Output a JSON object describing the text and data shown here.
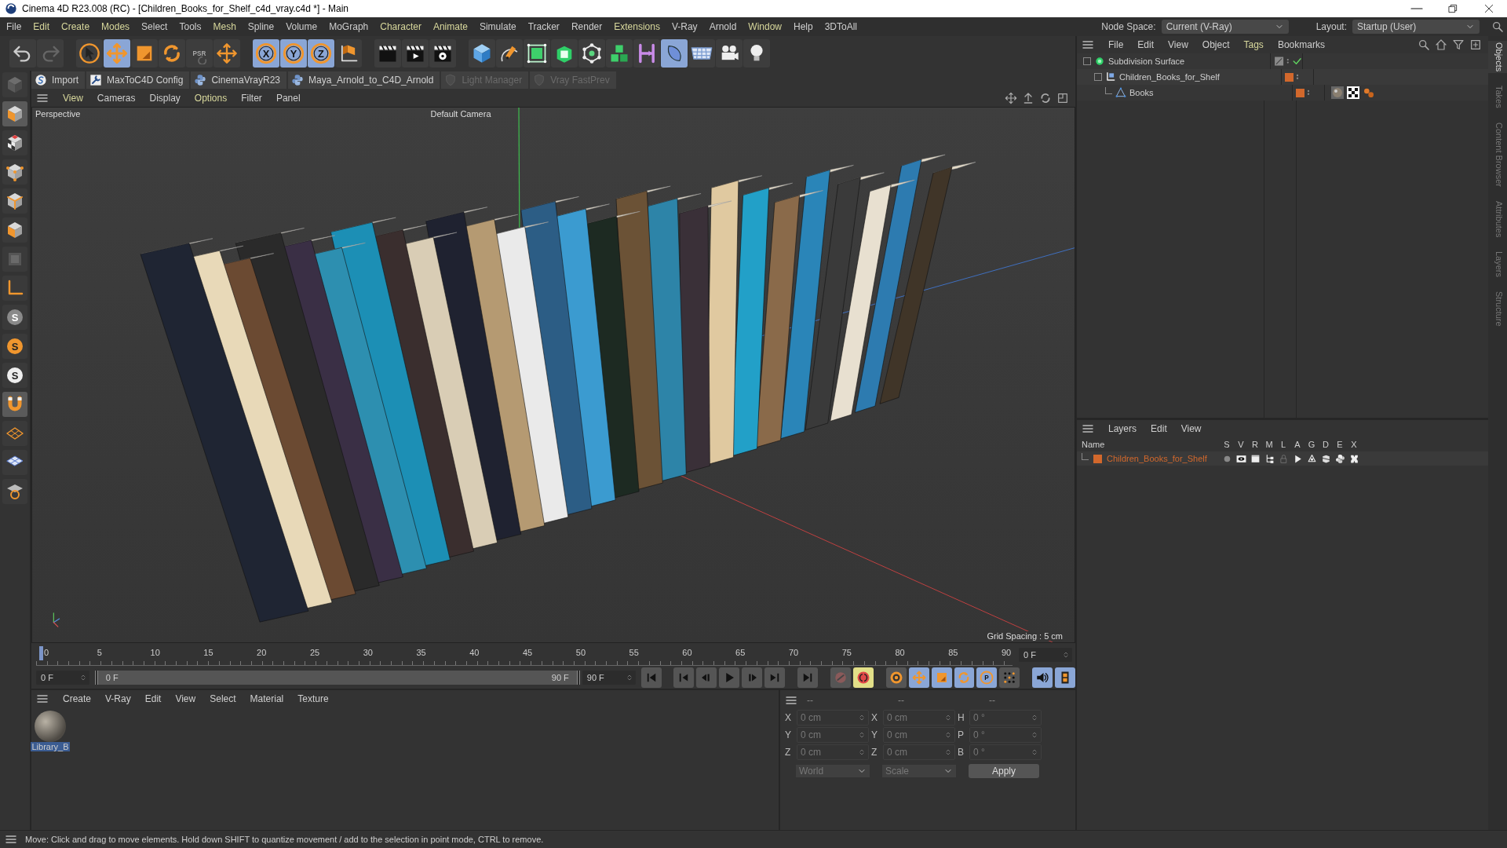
{
  "window": {
    "title": "Cinema 4D R23.008 (RC) - [Children_Books_for_Shelf_c4d_vray.c4d *] - Main"
  },
  "menu": [
    {
      "label": "File",
      "tinted": false
    },
    {
      "label": "Edit",
      "tinted": true
    },
    {
      "label": "Create",
      "tinted": true
    },
    {
      "label": "Modes",
      "tinted": true
    },
    {
      "label": "Select",
      "tinted": false
    },
    {
      "label": "Tools",
      "tinted": false
    },
    {
      "label": "Mesh",
      "tinted": true
    },
    {
      "label": "Spline",
      "tinted": false
    },
    {
      "label": "Volume",
      "tinted": false
    },
    {
      "label": "MoGraph",
      "tinted": false
    },
    {
      "label": "Character",
      "tinted": true
    },
    {
      "label": "Animate",
      "tinted": true
    },
    {
      "label": "Simulate",
      "tinted": false
    },
    {
      "label": "Tracker",
      "tinted": false
    },
    {
      "label": "Render",
      "tinted": false
    },
    {
      "label": "Extensions",
      "tinted": true
    },
    {
      "label": "V-Ray",
      "tinted": false
    },
    {
      "label": "Arnold",
      "tinted": false
    },
    {
      "label": "Window",
      "tinted": true
    },
    {
      "label": "Help",
      "tinted": false
    },
    {
      "label": "3DToAll",
      "tinted": false
    }
  ],
  "node_space": {
    "label": "Node Space:",
    "value": "Current (V-Ray)"
  },
  "layout": {
    "label": "Layout:",
    "value": "Startup (User)"
  },
  "toolbar": [
    {
      "kind": "undo",
      "selected": false
    },
    {
      "kind": "redo",
      "selected": false
    },
    {
      "kind": "cursor",
      "selected": false
    },
    {
      "kind": "move",
      "selected": true
    },
    {
      "kind": "scale",
      "selected": false
    },
    {
      "kind": "rotate",
      "selected": false
    },
    {
      "kind": "psr",
      "glyph": "PSR",
      "selected": false
    },
    {
      "kind": "add",
      "selected": false
    },
    {
      "kind": "axis",
      "glyph": "X",
      "selected": true
    },
    {
      "kind": "axis",
      "glyph": "Y",
      "selected": true
    },
    {
      "kind": "axis",
      "glyph": "Z",
      "selected": true
    },
    {
      "kind": "coordinate",
      "selected": false
    },
    {
      "kind": "clapper",
      "selected": false
    },
    {
      "kind": "render",
      "selected": false
    },
    {
      "kind": "render-settings",
      "selected": false
    },
    {
      "kind": "cube",
      "selected": false
    },
    {
      "kind": "pen",
      "selected": false
    },
    {
      "kind": "subdivision",
      "selected": false
    },
    {
      "kind": "extrude",
      "selected": false
    },
    {
      "kind": "mograph",
      "selected": false
    },
    {
      "kind": "cubes",
      "selected": false
    },
    {
      "kind": "deformer",
      "selected": false
    },
    {
      "kind": "field",
      "selected": true
    },
    {
      "kind": "floor",
      "selected": false
    },
    {
      "kind": "camera",
      "selected": false
    },
    {
      "kind": "light",
      "selected": false
    }
  ],
  "plugin_bar": [
    {
      "label": "Import",
      "kind": "script",
      "disabled": false
    },
    {
      "label": "MaxToC4D Config",
      "kind": "wrench",
      "disabled": false
    },
    {
      "label": "CinemaVrayR23",
      "kind": "python",
      "disabled": false
    },
    {
      "label": "Maya_Arnold_to_C4D_Arnold",
      "kind": "python",
      "disabled": false
    },
    {
      "label": "Light Manager",
      "kind": "shield",
      "disabled": true
    },
    {
      "label": "Vray FastPrev",
      "kind": "shield",
      "disabled": true
    }
  ],
  "left_tools": [
    {
      "kind": "camera-cube",
      "selected": false
    },
    {
      "kind": "model",
      "selected": true
    },
    {
      "kind": "texture",
      "selected": false
    },
    {
      "kind": "points",
      "selected": false
    },
    {
      "kind": "edges",
      "selected": false
    },
    {
      "kind": "polygons",
      "selected": false
    },
    {
      "kind": "uv",
      "selected": false
    },
    {
      "kind": "axis-corner",
      "selected": false
    },
    {
      "kind": "snap",
      "glyph": "S",
      "selected": false
    },
    {
      "kind": "snap-orange",
      "glyph": "S",
      "selected": false
    },
    {
      "kind": "snap-white",
      "glyph": "S",
      "selected": false
    },
    {
      "kind": "magnet",
      "selected": true
    },
    {
      "kind": "workplane",
      "selected": false
    },
    {
      "kind": "grid",
      "selected": false
    },
    {
      "kind": "grid-snap",
      "selected": false
    }
  ],
  "viewport": {
    "menu": [
      {
        "label": "View",
        "tinted": true
      },
      {
        "label": "Cameras",
        "tinted": false
      },
      {
        "label": "Display",
        "tinted": false
      },
      {
        "label": "Options",
        "tinted": true
      },
      {
        "label": "Filter",
        "tinted": false
      },
      {
        "label": "Panel",
        "tinted": false
      }
    ],
    "view_name": "Perspective",
    "camera": "Default Camera",
    "grid_spacing": "Grid Spacing : 5 cm"
  },
  "timeline": {
    "ticks": [
      "0",
      "5",
      "10",
      "15",
      "20",
      "25",
      "30",
      "35",
      "40",
      "45",
      "50",
      "55",
      "60",
      "65",
      "70",
      "75",
      "80",
      "85",
      "90"
    ],
    "current": "0 F",
    "start": "0 F",
    "range": {
      "start": "0 F",
      "end": "90 F",
      "level": 1
    },
    "end": "90 F"
  },
  "transport": [
    {
      "kind": "first",
      "selected": false
    },
    {
      "kind": "prev-key",
      "selected": false
    },
    {
      "kind": "prev-frame",
      "selected": false
    },
    {
      "kind": "play",
      "selected": false
    },
    {
      "kind": "next-frame",
      "selected": false
    },
    {
      "kind": "next-key",
      "selected": false
    },
    {
      "kind": "last",
      "selected": false
    },
    {
      "kind": "autokey",
      "selected": false
    },
    {
      "kind": "record",
      "selected": true
    },
    {
      "kind": "keyset",
      "selected": false
    },
    {
      "kind": "move",
      "selected": true
    },
    {
      "kind": "scale",
      "selected": true
    },
    {
      "kind": "rotate",
      "selected": true
    },
    {
      "kind": "param",
      "glyph": "P",
      "selected": true
    },
    {
      "kind": "dots",
      "selected": false
    },
    {
      "kind": "sound",
      "selected": true
    },
    {
      "kind": "film",
      "selected": true
    }
  ],
  "material_manager": {
    "menu": [
      "Create",
      "V-Ray",
      "Edit",
      "View",
      "Select",
      "Material",
      "Texture"
    ],
    "materials": [
      {
        "name": "Library_B",
        "selected": true
      }
    ]
  },
  "coordinates": {
    "headers": [
      "--",
      "--",
      "--"
    ],
    "rows": [
      {
        "pos_label": "X",
        "pos": "0 cm",
        "size_label": "X",
        "size": "0 cm",
        "rot_label": "H",
        "rot": "0 °"
      },
      {
        "pos_label": "Y",
        "pos": "0 cm",
        "size_label": "Y",
        "size": "0 cm",
        "rot_label": "P",
        "rot": "0 °"
      },
      {
        "pos_label": "Z",
        "pos": "0 cm",
        "size_label": "Z",
        "size": "0 cm",
        "rot_label": "B",
        "rot": "0 °"
      }
    ],
    "mode": "World",
    "transform": "Scale",
    "apply": "Apply"
  },
  "objects": {
    "menu": [
      {
        "label": "File",
        "tinted": false
      },
      {
        "label": "Edit",
        "tinted": false
      },
      {
        "label": "View",
        "tinted": false
      },
      {
        "label": "Object",
        "tinted": false
      },
      {
        "label": "Tags",
        "tinted": true
      },
      {
        "label": "Bookmarks",
        "tinted": false
      }
    ],
    "tree": [
      {
        "name": "Subdivision Surface",
        "kind": "subdivision",
        "enabled": true,
        "children": [
          {
            "name": "Children_Books_for_Shelf",
            "kind": "null",
            "color": "#d2682c",
            "children": [
              {
                "name": "Books",
                "kind": "polygon",
                "color": "#d2682c",
                "tags": [
                  {
                    "kind": "material"
                  },
                  {
                    "kind": "checker"
                  },
                  {
                    "kind": "vray"
                  }
                ]
              }
            ]
          }
        ]
      }
    ]
  },
  "layers": {
    "menu": [
      "Layers",
      "Edit",
      "View"
    ],
    "columns": [
      "Name",
      "S",
      "V",
      "R",
      "M",
      "L",
      "A",
      "G",
      "D",
      "E",
      "X"
    ],
    "rows": [
      {
        "name": "Children_Books_for_Shelf",
        "color": "#d2682c"
      }
    ]
  },
  "side_tabs": [
    {
      "label": "Objects",
      "selected": true
    },
    {
      "label": "Takes",
      "selected": false
    },
    {
      "label": "Content Browser",
      "selected": false
    },
    {
      "label": "Attributes",
      "selected": false
    },
    {
      "label": "Layers",
      "selected": false
    },
    {
      "label": "Structure",
      "selected": false
    }
  ],
  "status_bar": "Move: Click and drag to move elements. Hold down SHIFT to quantize movement / add to the selection in point mode, CTRL to remove."
}
